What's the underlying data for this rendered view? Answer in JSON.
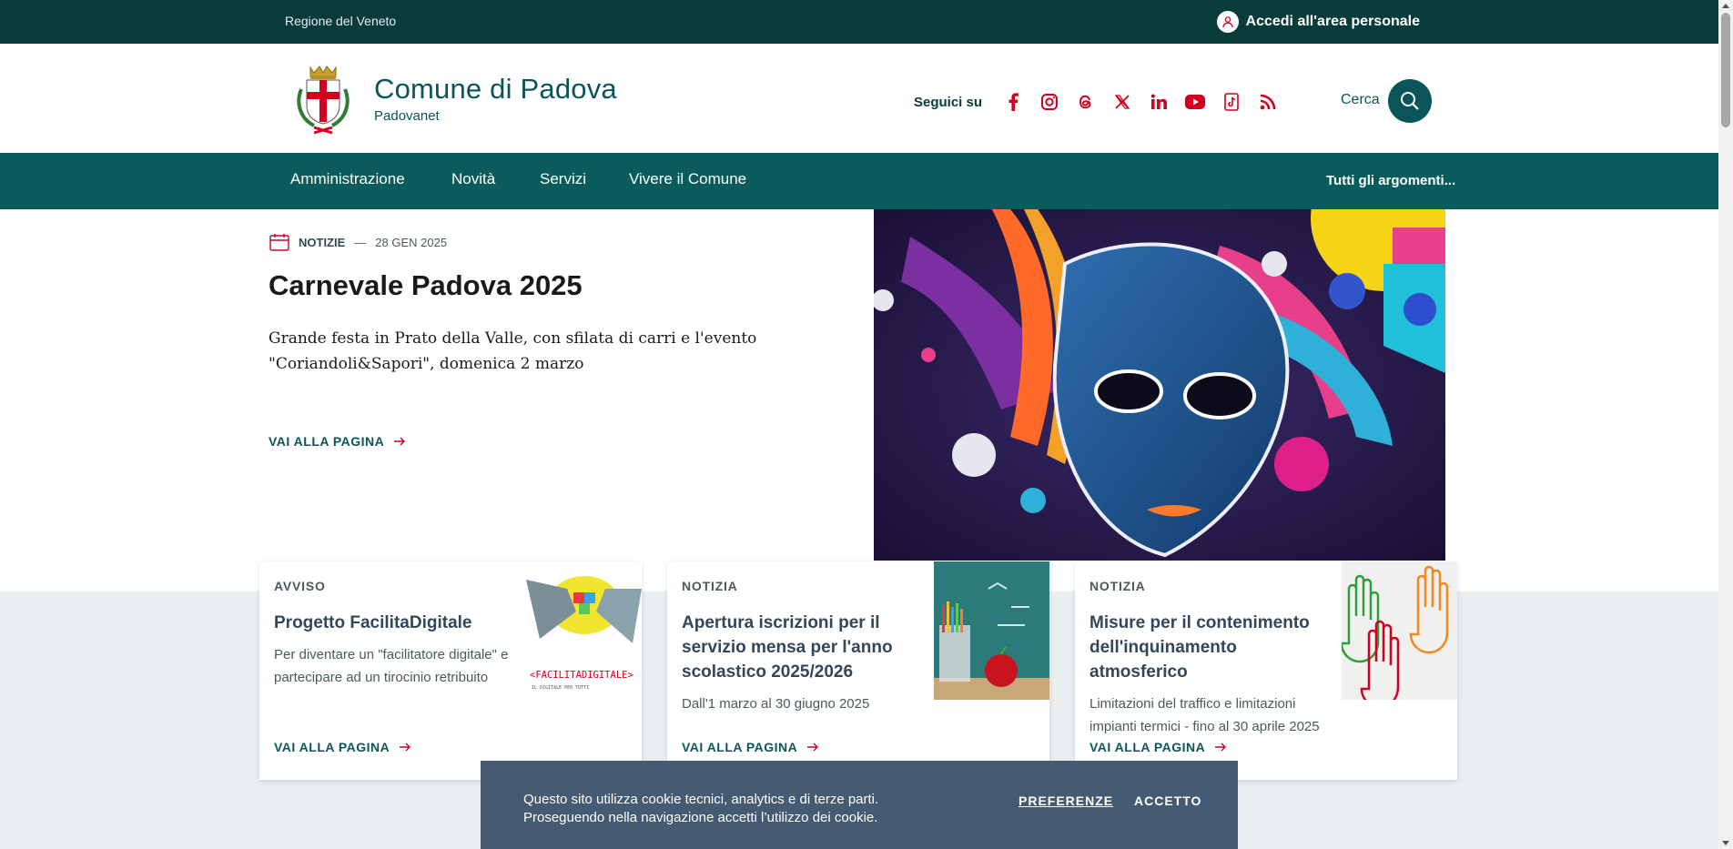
{
  "topbar": {
    "region": "Regione del Veneto",
    "login": "Accedi all'area personale"
  },
  "header": {
    "title": "Comune di Padova",
    "subtitle": "Padovanet",
    "follow_label": "Seguici su",
    "social_icons": [
      "facebook-icon",
      "instagram-icon",
      "threads-icon",
      "x-icon",
      "linkedin-icon",
      "youtube-icon",
      "tiktok-icon",
      "rss-icon"
    ],
    "search_label": "Cerca"
  },
  "nav": {
    "items": [
      "Amministrazione",
      "Novità",
      "Servizi",
      "Vivere il Comune"
    ],
    "all_topics": "Tutti gli argomenti..."
  },
  "hero": {
    "category": "NOTIZIE",
    "date": "28 GEN 2025",
    "title": "Carnevale Padova 2025",
    "description": "Grande festa in Prato della Valle, con sfilata di carri e l'evento \"Coriandoli&Sapori\", domenica 2 marzo",
    "more": "VAI ALLA PAGINA"
  },
  "cards": [
    {
      "type": "AVVISO",
      "title": "Progetto FacilitaDigitale",
      "description": "Per diventare un \"facilitatore digitale\" e partecipare ad un tirocinio retribuito",
      "more": "VAI ALLA PAGINA",
      "image_text": "<FACILITADIGITALE>",
      "image_subtext": "IL DIGITALE PER TUTTI"
    },
    {
      "type": "NOTIZIA",
      "title": "Apertura iscrizioni per il servizio mensa per l'anno scolastico 2025/2026",
      "description": "Dall'1 marzo al 30 giugno 2025",
      "more": "VAI ALLA PAGINA"
    },
    {
      "type": "NOTIZIA",
      "title": "Misure per il contenimento dell'inquinamento atmosferico",
      "description": "Limitazioni del traffico e limitazioni impianti termici - fino al 30 aprile 2025",
      "more": "VAI ALLA PAGINA"
    }
  ],
  "cookie": {
    "line1": "Questo sito utilizza cookie tecnici, analytics e di terze parti.",
    "line2": "Proseguendo nella navigazione accetti l’utilizzo dei cookie.",
    "preferences": "PREFERENZE",
    "accept": "ACCETTO"
  },
  "colors": {
    "topbar": "#0a3b3b",
    "nav": "#0a5c5c",
    "brand": "#0a5559",
    "accent_red": "#d1001f",
    "cookie_bg": "#455a73"
  }
}
